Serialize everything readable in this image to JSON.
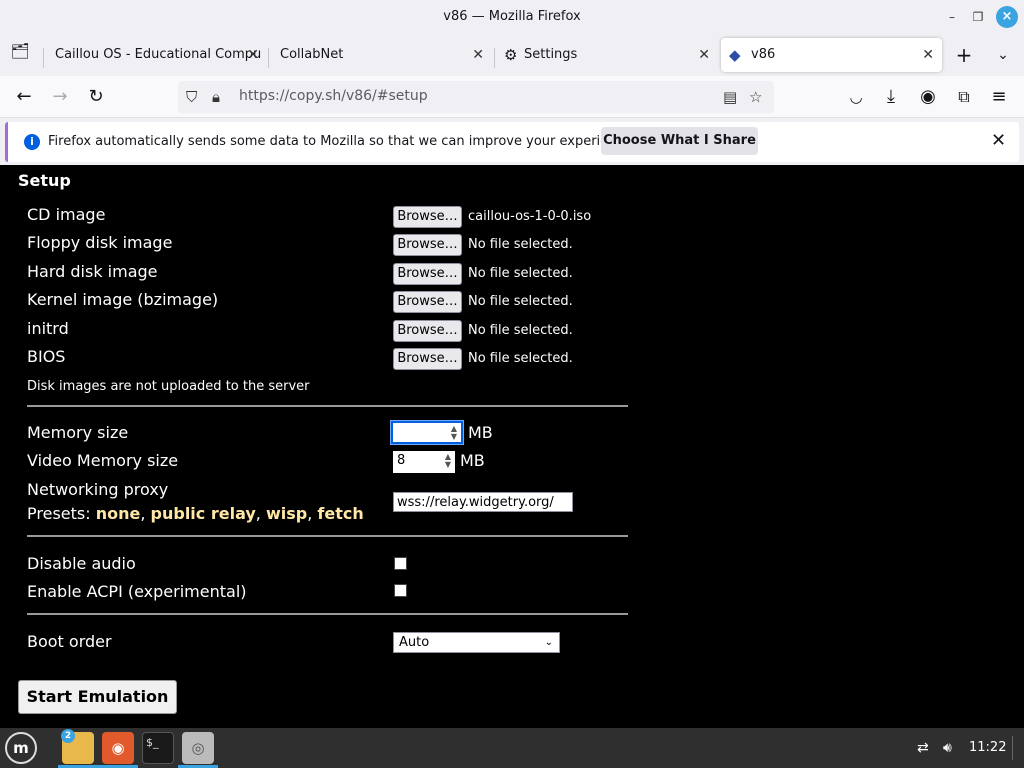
{
  "window": {
    "title": "v86 — Mozilla Firefox"
  },
  "tabs": [
    {
      "label": "Caillou OS - Educational Compu"
    },
    {
      "label": "CollabNet"
    },
    {
      "label": "Settings"
    },
    {
      "label": "v86"
    }
  ],
  "urlbar": {
    "url": "https://copy.sh/v86/#setup"
  },
  "notification": {
    "message": "Firefox automatically sends some data to Mozilla so that we can improve your experience.",
    "button": "Choose What I Share"
  },
  "setup": {
    "heading": "Setup",
    "browse_label": "Browse…",
    "files": [
      {
        "label": "CD image",
        "file": "caillou-os-1-0-0.iso"
      },
      {
        "label": "Floppy disk image",
        "file": "No file selected."
      },
      {
        "label": "Hard disk image",
        "file": "No file selected."
      },
      {
        "label": "Kernel image (bzimage)",
        "file": "No file selected."
      },
      {
        "label": "initrd",
        "file": "No file selected."
      },
      {
        "label": "BIOS",
        "file": "No file selected."
      }
    ],
    "disk_note": "Disk images are not uploaded to the server",
    "memory": {
      "label": "Memory size",
      "value": "",
      "unit": "MB"
    },
    "video_memory": {
      "label": "Video Memory size",
      "value": "8",
      "unit": "MB"
    },
    "proxy": {
      "label": "Networking proxy",
      "presets_label": "Presets:",
      "presets": [
        "none",
        "public relay",
        "wisp",
        "fetch"
      ],
      "value": "wss://relay.widgetry.org/"
    },
    "disable_audio": {
      "label": "Disable audio",
      "checked": false
    },
    "enable_acpi": {
      "label": "Enable ACPI (experimental)",
      "checked": false
    },
    "boot_order": {
      "label": "Boot order",
      "value": "Auto"
    },
    "start_button": "Start Emulation"
  },
  "taskbar": {
    "files_badge": "2",
    "clock": "11:22"
  },
  "colors": {
    "accent": "#0060df",
    "page_bg": "#000000",
    "preset_link": "#ffe7a6",
    "taskbar_bg": "#2f2f2f",
    "taskbar_accent": "#3aa3e0"
  }
}
